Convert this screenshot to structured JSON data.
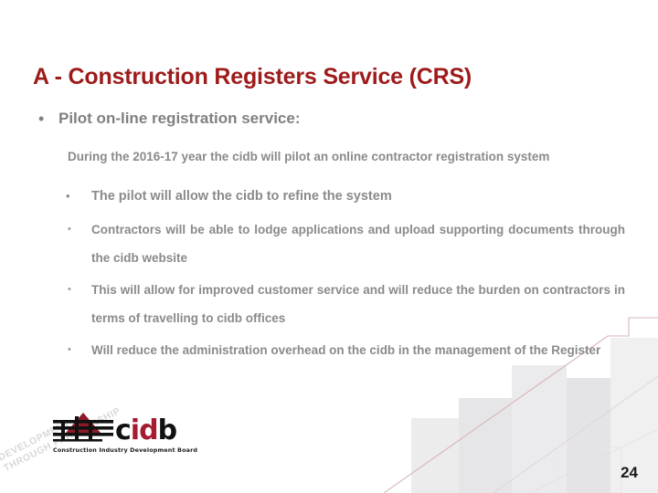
{
  "slide": {
    "title": "A - Construction Registers Service (CRS)",
    "page_number": "24",
    "title_color": "#9E1B1B",
    "body_color": "#808080",
    "background_color": "#FFFFFF"
  },
  "bullets": {
    "level1": {
      "marker": "•",
      "text": "Pilot on-line registration service:"
    },
    "level2": {
      "text": "During the 2016-17 year the cidb will pilot an online contractor registration system"
    },
    "level3": {
      "marker": "•",
      "text": "The pilot will allow the cidb to refine the system"
    },
    "level4_items": [
      {
        "marker": "•",
        "text": "Contractors will be able to lodge applications and upload supporting documents through the cidb website"
      },
      {
        "marker": "•",
        "text": "This will allow for improved customer service and will reduce the burden on contractors in terms of travelling to cidb offices"
      },
      {
        "marker": "•",
        "text": "Will reduce the administration overhead on the cidb in the management of the Register"
      }
    ]
  },
  "logo": {
    "word_part1": "c",
    "word_part2": "id",
    "word_part3": "b",
    "tagline": "Construction Industry Development Board",
    "mark_red": "#A51C30",
    "mark_black": "#111111"
  },
  "watermark": {
    "line1": "DEVELOPMENT",
    "line2": "THROUGH PARTNERSHIP",
    "color": "#D8D8DC"
  }
}
